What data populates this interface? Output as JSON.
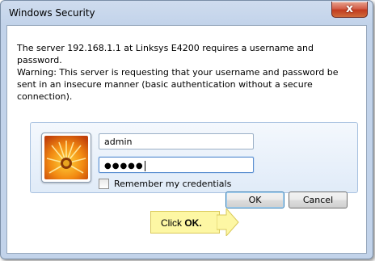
{
  "dialog": {
    "title": "Windows Security",
    "close_glyph": "x",
    "message": "The server 192.168.1.1 at Linksys E4200 requires a username and password.",
    "warning": "Warning: This server is requesting that your username and password be sent in an insecure manner (basic authentication without a secure connection)."
  },
  "credentials": {
    "username_value": "admin",
    "password_mask": "●●●●●",
    "remember_label": "Remember my credentials",
    "remember_checked": false
  },
  "buttons": {
    "ok_label": "OK",
    "cancel_label": "Cancel"
  },
  "annotation": {
    "prefix": "Click ",
    "bold_text": "OK."
  },
  "icons": {
    "close": "close-icon",
    "user_tile": "flower-user-tile-icon",
    "arrow": "yellow-arrow-icon"
  },
  "colors": {
    "titlebar": "#c2d3ea",
    "credential_panel": "#e0ebf8",
    "close_button": "#c23c1f",
    "callout": "#fdf7a4"
  }
}
